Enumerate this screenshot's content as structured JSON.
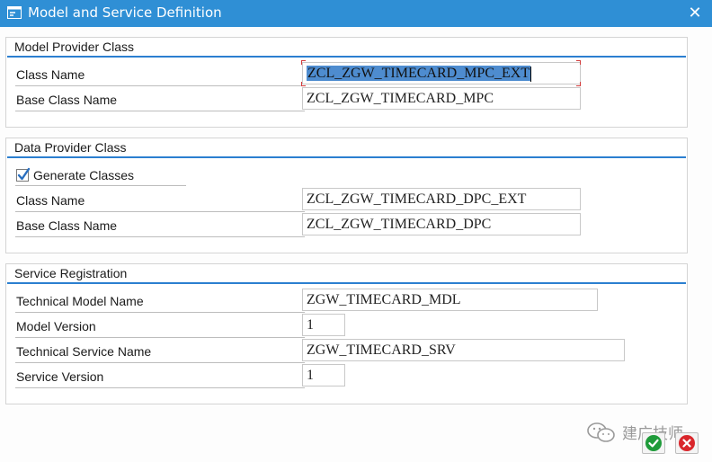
{
  "window": {
    "title": "Model and Service Definition",
    "title_icon": "form-icon",
    "close_icon": "close-icon"
  },
  "model_provider": {
    "title": "Model Provider Class",
    "class_name_label": "Class Name",
    "class_name_value": "ZCL_ZGW_TIMECARD_MPC_EXT",
    "base_class_label": "Base Class Name",
    "base_class_value": "ZCL_ZGW_TIMECARD_MPC"
  },
  "data_provider": {
    "title": "Data Provider Class",
    "generate_label": "Generate Classes",
    "generate_checked": true,
    "class_name_label": "Class Name",
    "class_name_value": "ZCL_ZGW_TIMECARD_DPC_EXT",
    "base_class_label": "Base Class Name",
    "base_class_value": "ZCL_ZGW_TIMECARD_DPC"
  },
  "service_registration": {
    "title": "Service Registration",
    "tech_model_label": "Technical Model Name",
    "tech_model_value": "ZGW_TIMECARD_MDL",
    "model_version_label": "Model Version",
    "model_version_value": "1",
    "tech_service_label": "Technical Service Name",
    "tech_service_value": "ZGW_TIMECARD_SRV",
    "service_version_label": "Service Version",
    "service_version_value": "1"
  },
  "footer": {
    "watermark_text": "建广技师",
    "confirm_icon": "check-icon",
    "cancel_icon": "cancel-icon"
  },
  "colors": {
    "titlebar": "#2f8fd5",
    "group_line": "#2b7fd0",
    "selection": "#4e8ccf",
    "confirm": "#1f9b3a",
    "cancel": "#d9262b"
  }
}
